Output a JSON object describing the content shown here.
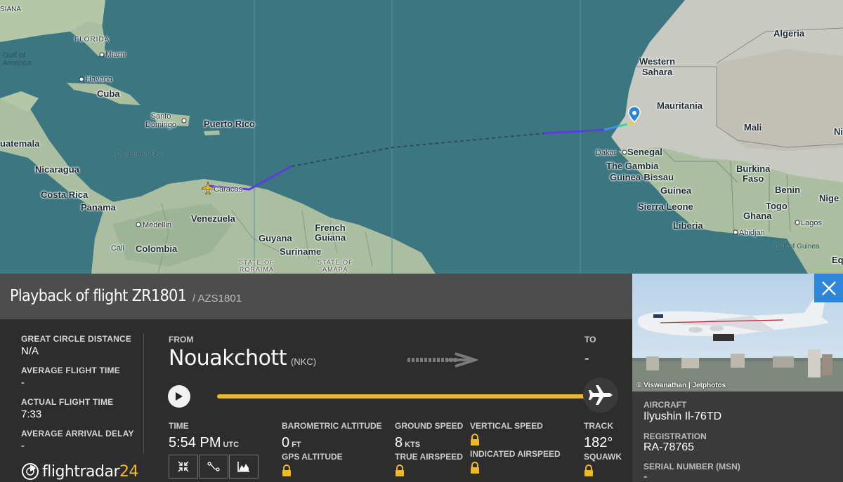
{
  "map": {
    "labels": {
      "algeria": "Algeria",
      "western_sahara": "Western\nSahara",
      "mauritania": "Mauritania",
      "mali": "Mali",
      "senegal": "Senegal",
      "dakar": "Dakar",
      "gambia": "The Gambia",
      "guinea_bissau": "Guinea-Bissau",
      "guinea": "Guinea",
      "sierra_leone": "Sierra Leone",
      "liberia": "Liberia",
      "burkina": "Burkina\nFaso",
      "ghana": "Ghana",
      "togo": "Togo",
      "benin": "Benin",
      "niger": "Nige",
      "lagos": "Lagos",
      "abidjan": "Abidjan",
      "gulf_guinea": "Gulf of Guinea",
      "florida": "FLORIDA",
      "miami": "Miami",
      "gulf_mexico": "Gulf of\nAmerica",
      "havana": "Havana",
      "cuba": "Cuba",
      "santo_domingo": "Santo\nDomingo",
      "puerto_rico": "Puerto Rico",
      "caribbean": "Caribbean Sea",
      "guatemala": "uatemala",
      "nicaragua": "Nicaragua",
      "costa_rica": "Costa Rica",
      "panama": "Panama",
      "caracas": "Caracas",
      "venezuela": "Venezuela",
      "medellin": "Medellin",
      "cali": "Cali",
      "colombia": "Colombia",
      "guyana": "Guyana",
      "suriname": "Suriname",
      "french_guiana": "French\nGuiana",
      "roraima": "STATE OF\nRORAIMA",
      "amapa": "STATE OF\nAMAPÁ",
      "louisiana": "SIANA",
      "eq": "Eq"
    }
  },
  "panel": {
    "title": "Playback of flight ZR1801",
    "alt_callsign": "/ AZS1801",
    "stats": [
      {
        "label": "GREAT CIRCLE DISTANCE",
        "value": "N/A"
      },
      {
        "label": "AVERAGE FLIGHT TIME",
        "value": "-"
      },
      {
        "label": "ACTUAL FLIGHT TIME",
        "value": "7:33"
      },
      {
        "label": "AVERAGE ARRIVAL DELAY",
        "value": "-"
      }
    ],
    "logo_prefix": "flightradar",
    "logo_suffix": "24",
    "from_label": "FROM",
    "from_city": "Nouakchott",
    "from_code": "(NKC)",
    "to_label": "TO",
    "to_value": "-",
    "progress": 1.0,
    "time_label": "TIME",
    "time_value": "5:54 PM",
    "time_unit": "UTC",
    "baro_label": "BAROMETRIC ALTITUDE",
    "baro_value": "0",
    "baro_unit": "FT",
    "gps_label": "GPS ALTITUDE",
    "gs_label": "GROUND SPEED",
    "gs_value": "8",
    "gs_unit": "KTS",
    "tas_label": "TRUE AIRSPEED",
    "vs_label": "VERTICAL SPEED",
    "ias_label": "INDICATED AIRSPEED",
    "track_label": "TRACK",
    "track_value": "182°",
    "squawk_label": "SQUAWK"
  },
  "aircraft": {
    "photo_credit": "© Viswanathan | Jetphotos",
    "aircraft_label": "AIRCRAFT",
    "aircraft_value": "Ilyushin Il-76TD",
    "registration_label": "REGISTRATION",
    "registration_value": "RA-78765",
    "serial_label": "SERIAL NUMBER (MSN)",
    "serial_value": "-"
  },
  "colors": {
    "accent": "#f2b824",
    "close_button": "#2e86d8",
    "track": "#5a3fe0",
    "ocean": "#3b7681"
  }
}
